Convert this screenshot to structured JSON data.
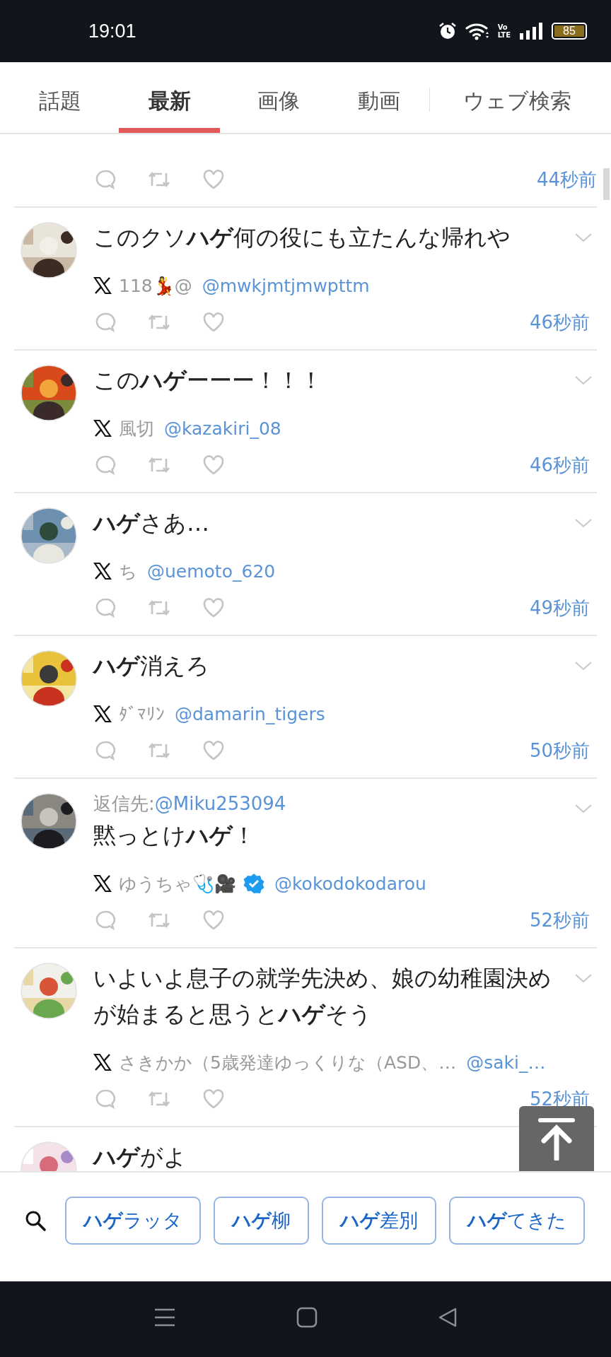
{
  "status_bar": {
    "time": "19:01",
    "network_label": [
      "Vo",
      "LTE"
    ],
    "battery": "85"
  },
  "tabs": [
    {
      "label": "話題",
      "selected": false
    },
    {
      "label": "最新",
      "selected": true
    },
    {
      "label": "画像",
      "selected": false
    },
    {
      "label": "動画",
      "selected": false
    },
    {
      "label": "ウェブ検索",
      "selected": false
    }
  ],
  "tweets": [
    {
      "kind": "partial_top",
      "time": "44秒前"
    },
    {
      "kind": "full",
      "text": "このクソ**ハゲ**何の役にも立たんな帰れや",
      "name": "118💃@",
      "verified": false,
      "handle": "@mwkjmtjmwpttm",
      "time": "46秒前"
    },
    {
      "kind": "full",
      "text": "この**ハゲ**ーーー！！！",
      "name": "風切",
      "verified": false,
      "handle": "@kazakiri_08",
      "time": "46秒前"
    },
    {
      "kind": "full",
      "text": "**ハゲ**さあ…",
      "name": "ち",
      "verified": false,
      "handle": "@uemoto_620",
      "time": "49秒前"
    },
    {
      "kind": "full",
      "text": "**ハゲ**消えろ",
      "name": "ﾀﾞﾏﾘﾝ",
      "verified": false,
      "handle": "@damarin_tigers",
      "time": "50秒前"
    },
    {
      "kind": "full",
      "reply_label": "返信先:",
      "reply_handle": "@Miku253094",
      "text": "黙っとけ**ハゲ**！",
      "name": "ゆうちゃ🩺🎥",
      "verified": true,
      "handle": "@kokodokodarou",
      "time": "52秒前"
    },
    {
      "kind": "full",
      "text": "いよいよ息子の就学先決め、娘の幼稚園決めが始まると思うと**ハゲ**そう",
      "name": "さきかか（5歳発達ゆっくりな（ASD、…",
      "verified": false,
      "handle": "@saki_…",
      "time": "52秒前"
    },
    {
      "kind": "partial_bottom",
      "text": "**ハゲ**がよ"
    }
  ],
  "suggestions": [
    {
      "label": "**ハゲ**ラッタ"
    },
    {
      "label": "**ハゲ**柳"
    },
    {
      "label": "**ハゲ**差別"
    },
    {
      "label": "**ハゲ**てきた"
    }
  ]
}
